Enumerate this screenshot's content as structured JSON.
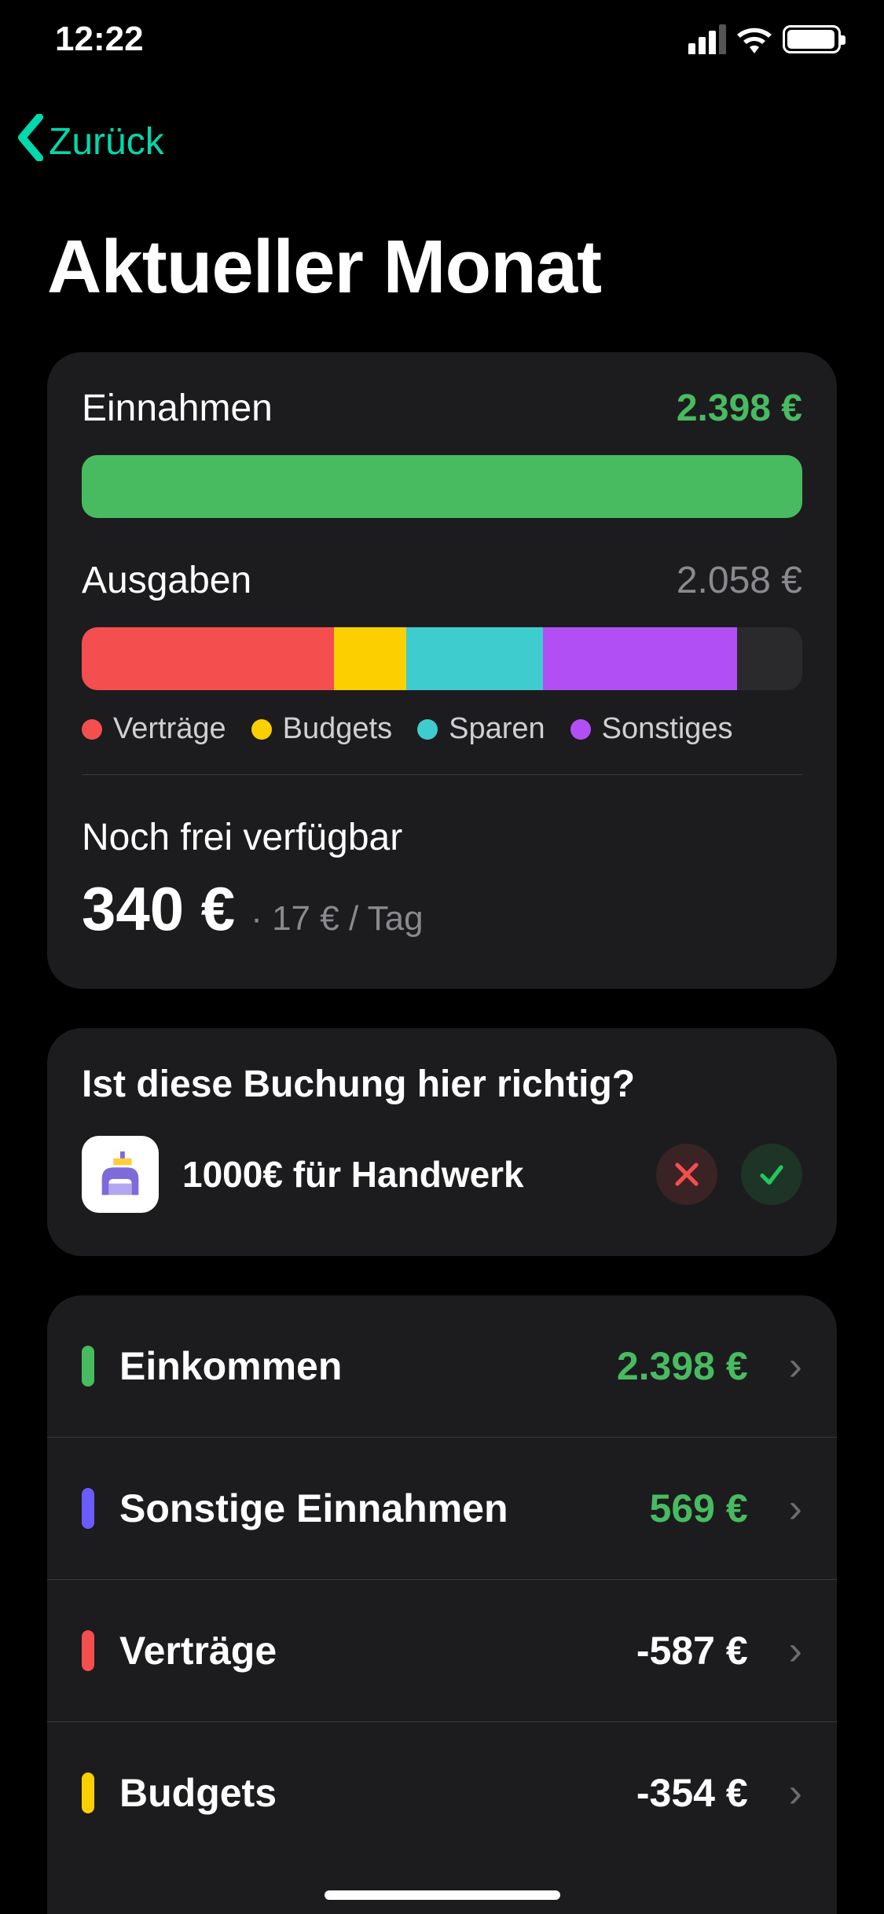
{
  "status_bar": {
    "time": "12:22"
  },
  "nav": {
    "back_label": "Zurück"
  },
  "page_title": "Aktueller Monat",
  "chart_data": {
    "type": "bar",
    "income_bar": {
      "label": "Einnahmen",
      "value": 2398,
      "display": "2.398 €",
      "fill_percent": 100
    },
    "expense_bar": {
      "label": "Ausgaben",
      "value": 2058,
      "display": "2.058 €",
      "series": [
        {
          "name": "Verträge",
          "color": "#f44e4e",
          "percent": 35
        },
        {
          "name": "Budgets",
          "color": "#fccf00",
          "percent": 10
        },
        {
          "name": "Sparen",
          "color": "#3ecccf",
          "percent": 19
        },
        {
          "name": "Sonstiges",
          "color": "#b14ff4",
          "percent": 27
        },
        {
          "name": "empty",
          "color": "#2a2a2c",
          "percent": 9
        }
      ]
    }
  },
  "summary": {
    "income_label": "Einnahmen",
    "income_value": "2.398 €",
    "expense_label": "Ausgaben",
    "expense_value": "2.058 €",
    "legend": {
      "0": {
        "label": "Verträge"
      },
      "1": {
        "label": "Budgets"
      },
      "2": {
        "label": "Sparen"
      },
      "3": {
        "label": "Sonstiges"
      }
    },
    "remaining_label": "Noch frei verfügbar",
    "remaining_value": "340 €",
    "remaining_per_day": "· 17 € / Tag"
  },
  "booking": {
    "question": "Ist diese Buchung hier richtig?",
    "text": "1000€ für Handwerk"
  },
  "categories": {
    "0": {
      "label": "Einkommen",
      "value": "2.398 €"
    },
    "1": {
      "label": "Sonstige Einnahmen",
      "value": "569 €"
    },
    "2": {
      "label": "Verträge",
      "value": "-587 €"
    },
    "3": {
      "label": "Budgets",
      "value": "-354 €"
    }
  }
}
